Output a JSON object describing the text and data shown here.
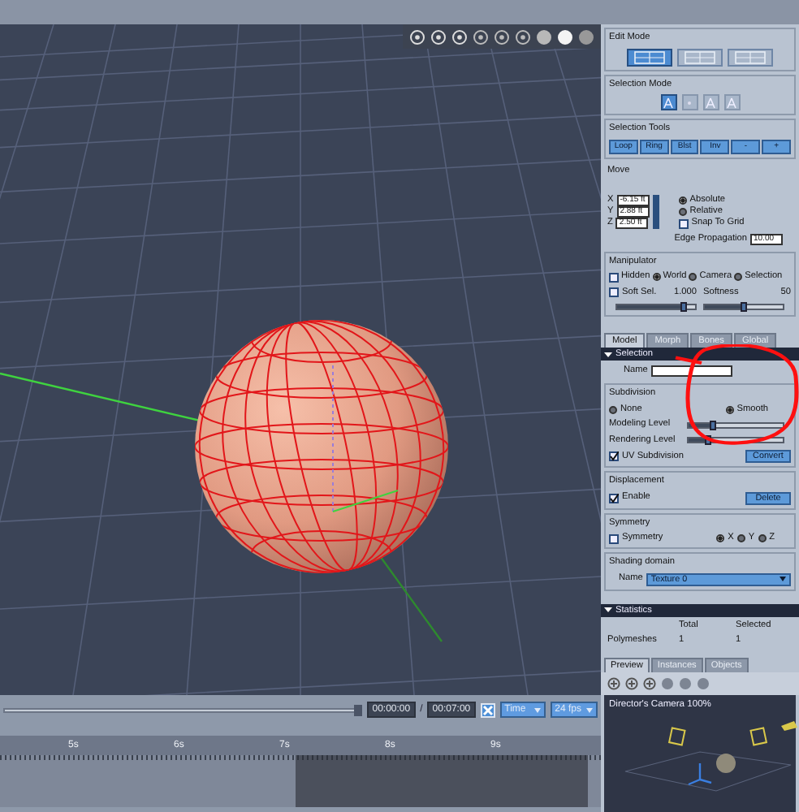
{
  "timeline": {
    "scrubber": {
      "level": 1
    },
    "current_time": "00:00:00",
    "separator": "/",
    "end_time": "00:07:00",
    "time_mode": "Time",
    "frame_rate": "24 fps",
    "ruler_labels": [
      "5s",
      "6s",
      "7s",
      "8s",
      "9s"
    ]
  },
  "edit_mode": {
    "title": "Edit Mode",
    "modes": [
      {
        "selected": true
      },
      {
        "selected": false
      },
      {
        "selected": false
      }
    ]
  },
  "selection_mode": {
    "title": "Selection Mode",
    "modes": [
      {
        "selected": true
      },
      {
        "selected": false
      },
      {
        "selected": false
      },
      {
        "selected": false
      }
    ]
  },
  "selection_tools": {
    "title": "Selection Tools",
    "buttons": [
      "Loop",
      "Ring",
      "Blst",
      "Inv",
      "-",
      "+"
    ]
  },
  "move": {
    "title": "Move",
    "coordinates": [
      {
        "axis": "X",
        "value": "-6.15 ft"
      },
      {
        "axis": "Y",
        "value": "2.88 ft"
      },
      {
        "axis": "Z",
        "value": "2.50 ft"
      }
    ],
    "modes": [
      {
        "label": "Absolute",
        "selected": true
      },
      {
        "label": "Relative",
        "selected": false
      }
    ],
    "snap_to_grid": {
      "label": "Snap To Grid",
      "checked": false
    },
    "edge_propagation": {
      "label": "Edge Propagation",
      "value": "10.00"
    }
  },
  "manipulator": {
    "title": "Manipulator",
    "hidden": {
      "label": "Hidden",
      "checked": false
    },
    "spaces": [
      {
        "label": "World",
        "selected": true
      },
      {
        "label": "Camera",
        "selected": false
      },
      {
        "label": "Selection",
        "selected": false
      }
    ],
    "soft_sel": {
      "label": "Soft Sel.",
      "checked": false,
      "reading": "1.000",
      "level": 0.85
    },
    "softness": {
      "label": "Softness",
      "reading": "50",
      "level": 0.5
    }
  },
  "tabs": [
    {
      "label": "Model",
      "selected": true
    },
    {
      "label": "Morph",
      "selected": false
    },
    {
      "label": "Bones",
      "selected": false
    },
    {
      "label": "Global",
      "selected": false
    }
  ],
  "selection": {
    "title": "Selection",
    "name_label": "Name",
    "subdivision": {
      "title": "Subdivision",
      "modes": [
        {
          "label": "None",
          "selected": false
        },
        {
          "label": "Smooth",
          "selected": true
        }
      ],
      "levels": [
        {
          "label": "Modeling Level",
          "level": 0.25
        },
        {
          "label": "Rendering Level",
          "level": 0.2
        }
      ],
      "uv_subdivision": {
        "label": "UV Subdivision",
        "checked": true
      },
      "convert_button": "Convert"
    },
    "displacement": {
      "title": "Displacement",
      "enable": {
        "label": "Enable",
        "checked": true
      },
      "delete_button": "Delete"
    },
    "symmetry": {
      "title": "Symmetry",
      "checkbox": {
        "label": "Symmetry",
        "checked": false
      },
      "axes": [
        {
          "label": "X",
          "selected": true
        },
        {
          "label": "Y",
          "selected": false
        },
        {
          "label": "Z",
          "selected": false
        }
      ]
    },
    "shading_domain": {
      "title": "Shading domain",
      "name_label": "Name",
      "value": "Texture 0"
    }
  },
  "statistics": {
    "title": "Statistics",
    "columns": [
      "Total",
      "Selected"
    ],
    "rows": [
      {
        "label": "Polymeshes",
        "values": [
          "1",
          "1"
        ]
      }
    ]
  },
  "bottom_tabs": [
    {
      "label": "Preview",
      "selected": true
    },
    {
      "label": "Instances",
      "selected": false
    },
    {
      "label": "Objects",
      "selected": false
    }
  ],
  "preview": {
    "camera_label": "Director's Camera 100%"
  }
}
